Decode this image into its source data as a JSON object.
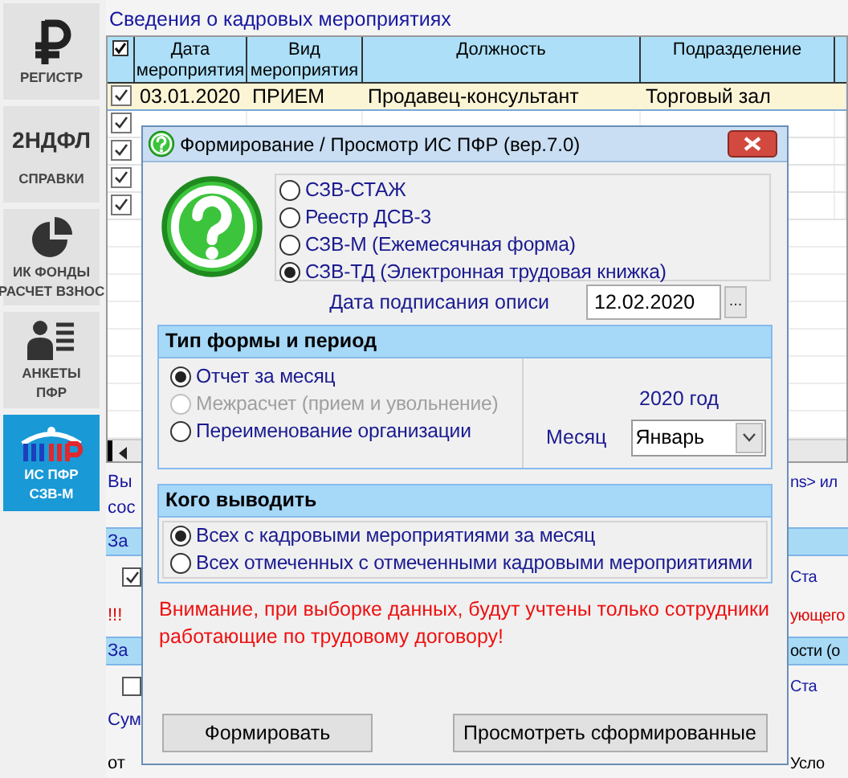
{
  "sidebar": {
    "items": [
      {
        "kind": "ruble",
        "lines": [
          "РЕГИСТР"
        ],
        "selected": false
      },
      {
        "kind": "text_logo",
        "logo": "2НДФЛ",
        "lines": [
          "СПРАВКИ"
        ],
        "selected": false
      },
      {
        "kind": "pie",
        "lines": [
          "ИК ФОНДЫ",
          "РАСЧЕТ ВЗНОС"
        ],
        "selected": false
      },
      {
        "kind": "person",
        "lines": [
          "АНКЕТЫ",
          "ПФР"
        ],
        "selected": false
      },
      {
        "kind": "pfr",
        "lines": [
          "ИС ПФР",
          "СЗВ-М"
        ],
        "selected": true
      }
    ]
  },
  "section_title": "Сведения о кадровых мероприятиях",
  "table": {
    "header_checked": true,
    "columns": [
      {
        "lines": [
          "Дата",
          "мероприятия"
        ]
      },
      {
        "lines": [
          "Вид",
          "мероприятия"
        ]
      },
      {
        "lines": [
          "Должность"
        ]
      },
      {
        "lines": [
          "Подразделение"
        ]
      }
    ],
    "rows": [
      {
        "checked": true,
        "selected": true,
        "cells": [
          "03.01.2020",
          "ПРИЕМ",
          "Продавец-консультант",
          "Торговый зал"
        ]
      },
      {
        "checked": true,
        "selected": false,
        "cells": []
      },
      {
        "checked": true,
        "selected": false,
        "cells": []
      },
      {
        "checked": true,
        "selected": false,
        "cells": []
      },
      {
        "checked": true,
        "selected": false,
        "cells": []
      }
    ]
  },
  "lower_rows": [
    {
      "kind": "text",
      "left": "Вы",
      "right": "ns> ил"
    },
    {
      "kind": "text",
      "left": "сос"
    },
    {
      "kind": "header",
      "left": "За"
    },
    {
      "kind": "checkbox",
      "checked": true,
      "right": "Ста"
    },
    {
      "kind": "warning",
      "left": "!!!",
      "right": "ующего"
    },
    {
      "kind": "header",
      "left": "За",
      "right": "ости (о"
    },
    {
      "kind": "checkbox",
      "checked": false,
      "right": "Ста"
    },
    {
      "kind": "text",
      "left": "Сум"
    },
    {
      "kind": "plain",
      "left": "от",
      "right": "Усло"
    }
  ],
  "dialog": {
    "title": "Формирование / Просмотр ИС ПФР (вер.7.0)",
    "report_types": [
      {
        "label": "СЗВ-СТАЖ",
        "selected": false
      },
      {
        "label": "Реестр ДСВ-3",
        "selected": false
      },
      {
        "label": "СЗВ-М (Ежемесячная форма)",
        "selected": false
      },
      {
        "label": "СЗВ-ТД (Электронная трудовая книжка)",
        "selected": true
      }
    ],
    "signing_date": {
      "label": "Дата подписания описи",
      "value": "12.02.2020",
      "button": "..."
    },
    "form_group": {
      "title": "Тип формы и период",
      "options": [
        {
          "label": "Отчет за месяц",
          "selected": true,
          "disabled": false
        },
        {
          "label": "Межрасчет (прием и увольнение)",
          "selected": false,
          "disabled": true
        },
        {
          "label": "Переименование организации",
          "selected": false,
          "disabled": false
        }
      ],
      "year": "2020 год",
      "month_label": "Месяц",
      "month": "Январь"
    },
    "output_group": {
      "title": "Кого выводить",
      "options": [
        {
          "label": "Всех с кадровыми мероприятиями за месяц",
          "selected": true,
          "disabled": false
        },
        {
          "label": "Всех отмеченных с отмеченными кадровыми мероприятиями",
          "selected": false,
          "disabled": false
        }
      ]
    },
    "warning": "Внимание, при выборке данных, будут учтены только сотрудники работающие по трудовому договору!",
    "buttons": [
      "Формировать",
      "Просмотреть сформированные"
    ]
  }
}
